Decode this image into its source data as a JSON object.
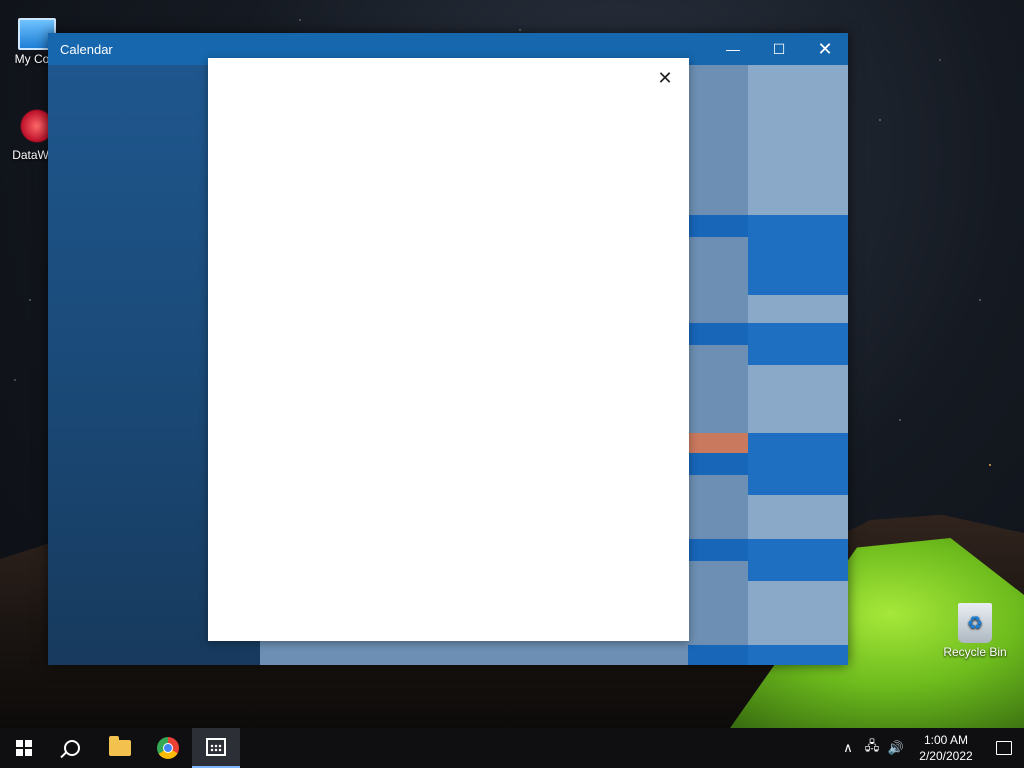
{
  "desktop": {
    "icons": [
      {
        "label": "My Com"
      },
      {
        "label": "DataWag"
      },
      {
        "label": "Recycle Bin"
      }
    ]
  },
  "window": {
    "title": "Calendar",
    "controls": {
      "minimize": "—",
      "maximize": "☐",
      "close": "✕"
    }
  },
  "dialog": {
    "close": "✕"
  },
  "taskbar": {
    "clock": {
      "time": "1:00 AM",
      "date": "2/20/2022"
    },
    "tray": {
      "chevron": "∧",
      "network": "🖧",
      "volume": "🔊"
    }
  },
  "colors": {
    "accent": "#1667ad",
    "taskbar": "#0f0f12",
    "dialog_bg": "#ffffff"
  }
}
